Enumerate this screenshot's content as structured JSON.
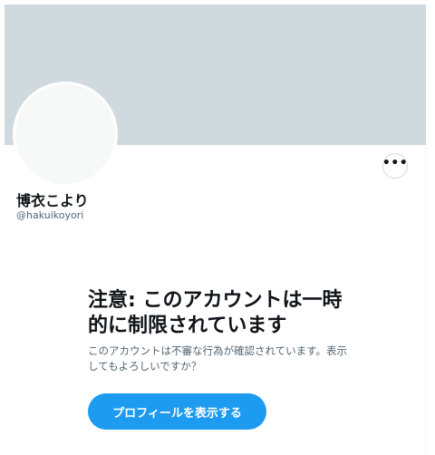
{
  "profile": {
    "display_name": "博衣こより",
    "username": "@hakuikoyori",
    "more_label": "•••"
  },
  "notice": {
    "title": "注意: このアカウントは一時的に制限されています",
    "body": "このアカウントは不審な行為が確認されています。表示してもよろしいですか？",
    "button_label": "プロフィールを表示する"
  },
  "colors": {
    "banner": "#cfd9de",
    "accent": "#1d9bf0",
    "primary_text": "#0f1419",
    "secondary_text": "#536471"
  }
}
